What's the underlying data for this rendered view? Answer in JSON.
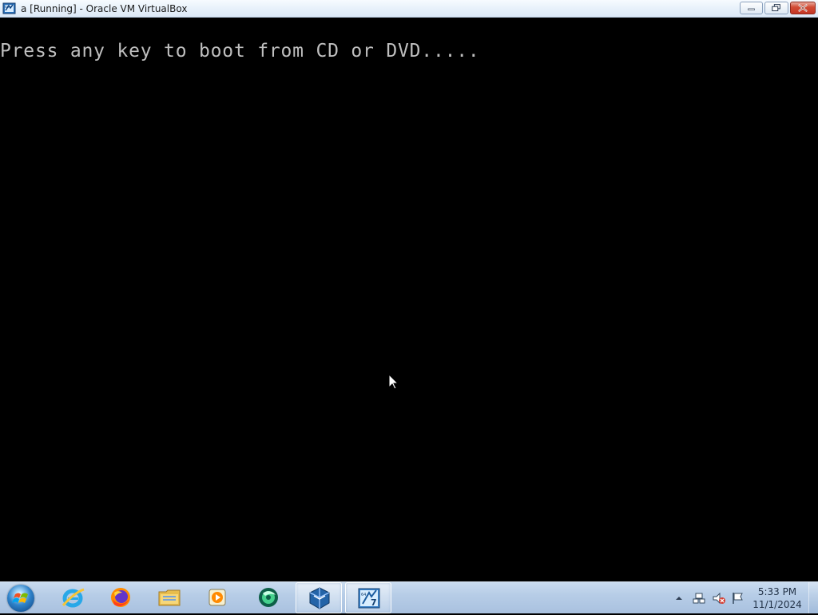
{
  "window": {
    "title": "a [Running] - Oracle VM VirtualBox",
    "icon": "virtualbox-window-icon",
    "controls": {
      "minimize": "minimize-icon",
      "maximize": "restore-icon",
      "close": "close-icon"
    }
  },
  "vm_display": {
    "boot_message": "Press any key to boot from CD or DVD.....",
    "text_color": "#bfbfbf",
    "background": "#000000"
  },
  "taskbar": {
    "start_icon": "windows-start-orb-icon",
    "pinned_apps": [
      {
        "name": "internet-explorer",
        "icon": "internet-explorer-icon",
        "active": false
      },
      {
        "name": "firefox",
        "icon": "firefox-icon",
        "active": false
      },
      {
        "name": "file-explorer",
        "icon": "folder-icon",
        "active": false
      },
      {
        "name": "media-player",
        "icon": "media-player-icon",
        "active": false
      },
      {
        "name": "camtasia",
        "icon": "camtasia-icon",
        "active": false
      },
      {
        "name": "virtualbox-manager",
        "icon": "virtualbox-icon",
        "active": true
      },
      {
        "name": "virtualbox-vm-window",
        "icon": "windows7-vm-icon",
        "active": true
      }
    ],
    "tray": {
      "icons": [
        "chevron-up-icon",
        "network-icon",
        "volume-muted-icon",
        "action-center-flag-icon"
      ],
      "time": "5:33 PM",
      "date": "11/1/2024"
    }
  },
  "colors": {
    "titlebar": "#e9f2fb",
    "close_button": "#d24c35",
    "taskbar": "#b7cde7",
    "accent": "#2e82c9"
  }
}
